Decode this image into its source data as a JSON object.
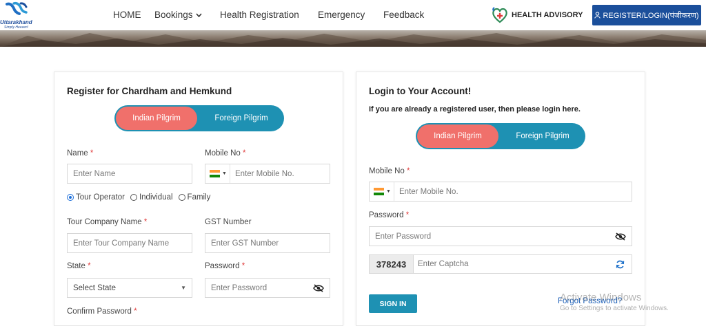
{
  "header": {
    "logo_brand": "Uttarakhand",
    "logo_tagline": "Simply Heaven!",
    "nav": [
      {
        "label": "HOME"
      },
      {
        "label": "Bookings"
      },
      {
        "label": "Health Registration"
      },
      {
        "label": "Emergency"
      },
      {
        "label": "Feedback"
      }
    ],
    "health_advisory": "HEALTH ADVISORY",
    "register_login": "REGISTER/LOGIN(पंजीकरण)"
  },
  "register": {
    "title": "Register for Chardham and Hemkund",
    "toggle": {
      "active": "Indian Pilgrim",
      "other": "Foreign Pilgrim"
    },
    "name_label": "Name",
    "name_placeholder": "Enter Name",
    "mobile_label": "Mobile No",
    "mobile_placeholder": "Enter  Mobile No.",
    "radios": [
      {
        "label": "Tour Operator",
        "selected": true
      },
      {
        "label": "Individual",
        "selected": false
      },
      {
        "label": "Family",
        "selected": false
      }
    ],
    "company_label": "Tour Company Name",
    "company_placeholder": "Enter Tour Company Name",
    "gst_label": "GST Number",
    "gst_placeholder": "Enter GST Number",
    "state_label": "State",
    "state_value": "Select State",
    "password_label": "Password",
    "password_placeholder": "Enter  Password",
    "confirm_label": "Confirm Password",
    "required_mark": "*"
  },
  "login": {
    "title": "Login to Your Account!",
    "note": "If you are already a registered user, then please login here.",
    "toggle": {
      "active": "Indian Pilgrim",
      "other": "Foreign Pilgrim"
    },
    "mobile_label": "Mobile No",
    "mobile_placeholder": "Enter  Mobile No.",
    "password_label": "Password",
    "password_placeholder": "Enter  Password",
    "captcha_code": "378243",
    "captcha_placeholder": "Enter Captcha",
    "signin": "SIGN IN",
    "forgot": "Forgot Password?",
    "required_mark": "*"
  },
  "watermark": {
    "line1": "Activate Windows",
    "line2": "Go to Settings to activate Windows."
  },
  "colors": {
    "primary_blue": "#1b4f9b",
    "teal": "#1e91b3",
    "coral": "#f0706b",
    "required": "#e03b3b"
  }
}
